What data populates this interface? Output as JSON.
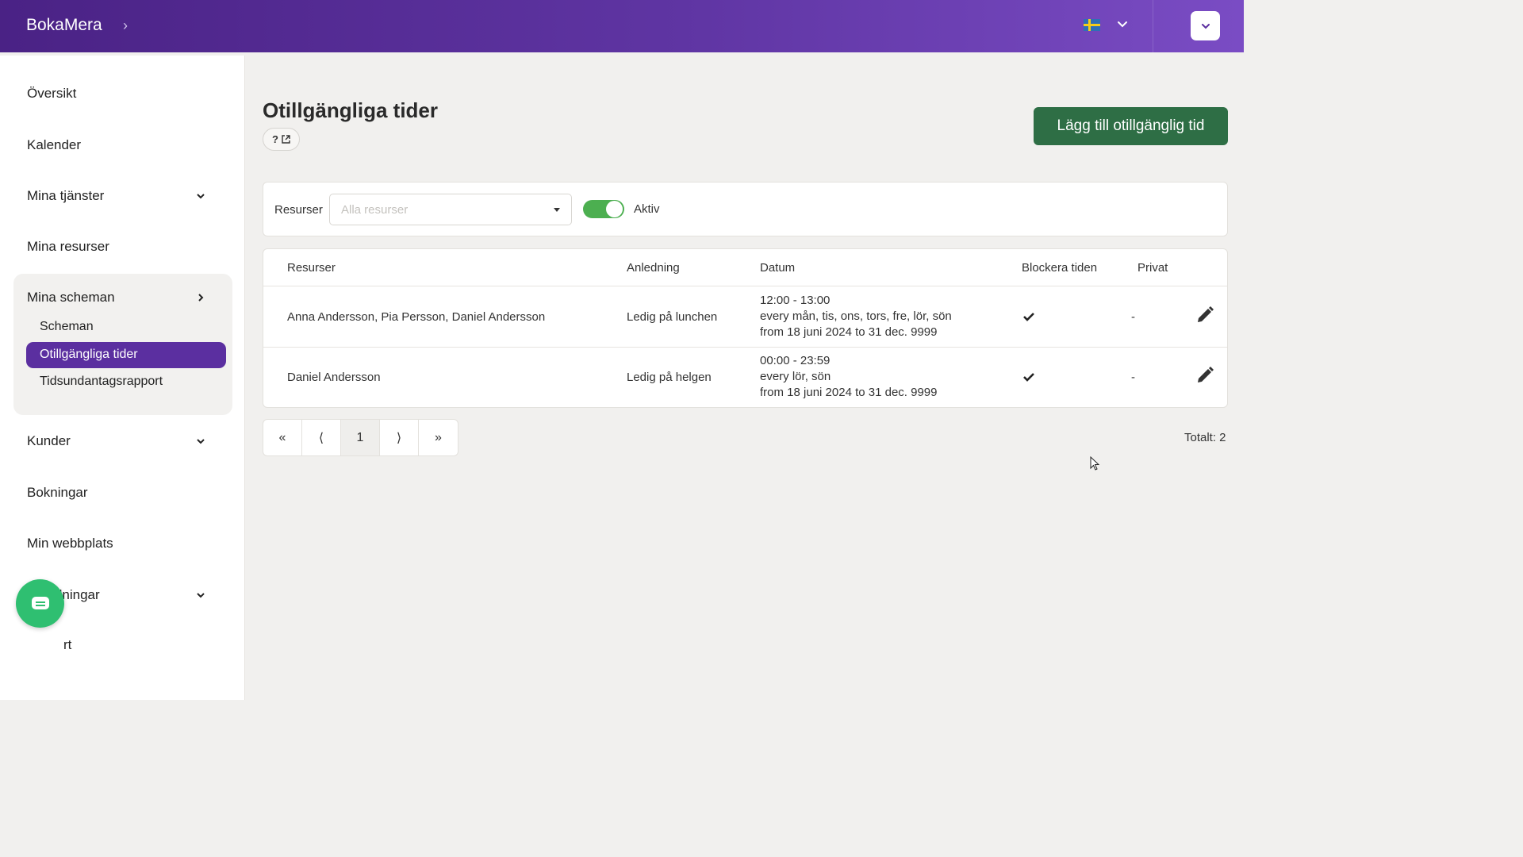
{
  "app": {
    "brand": "BokaMera"
  },
  "header": {
    "language_flag": "sweden-flag",
    "user_menu_icon": "chevron-down-icon"
  },
  "sidebar": {
    "items": [
      {
        "label": "Översikt"
      },
      {
        "label": "Kalender"
      },
      {
        "label": "Mina tjänster"
      },
      {
        "label": "Mina resurser"
      },
      {
        "label": "Mina scheman"
      },
      {
        "label": "Kunder"
      },
      {
        "label": "Bokningar"
      },
      {
        "label": "Min webbplats"
      },
      {
        "label": "Inställningar"
      },
      {
        "label": "rt"
      }
    ],
    "sub_items": [
      {
        "label": "Scheman"
      },
      {
        "label": "Otillgängliga tider"
      },
      {
        "label": "Tidsundantagsrapport"
      }
    ]
  },
  "page": {
    "title": "Otillgängliga tider",
    "help_label": "?",
    "add_button": "Lägg till otillgänglig tid"
  },
  "filters": {
    "resources_label": "Resurser",
    "resources_placeholder": "Alla resurser",
    "active_label": "Aktiv",
    "active_on": true
  },
  "table": {
    "headers": [
      "Resurser",
      "Anledning",
      "Datum",
      "Blockera tiden",
      "Privat"
    ],
    "rows": [
      {
        "resources": "Anna Andersson, Pia Persson, Daniel Andersson",
        "reason": "Ledig på lunchen",
        "time": "12:00 - 13:00",
        "days": "every mån, tis, ons, tors, fre, lör, sön",
        "range": "from 18 juni 2024 to 31 dec. 9999",
        "private": "-"
      },
      {
        "resources": "Daniel Andersson",
        "reason": "Ledig på helgen",
        "time": "00:00 - 23:59",
        "days": "every lör, sön",
        "range": "from 18 juni 2024 to 31 dec. 9999",
        "private": "-"
      }
    ]
  },
  "pagination": {
    "first": "«",
    "prev": "⟨",
    "current": "1",
    "next": "⟩",
    "last": "»",
    "total": "Totalt: 2"
  }
}
